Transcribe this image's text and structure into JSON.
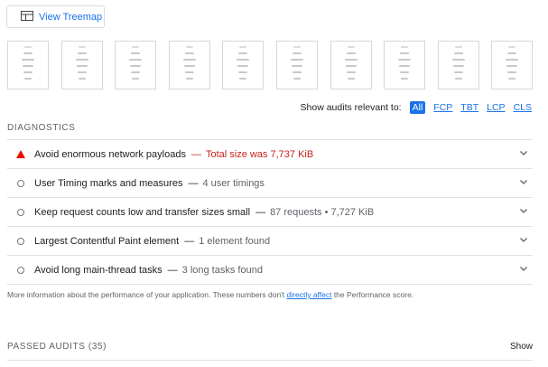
{
  "treemap_button": {
    "label": "View Treemap"
  },
  "filmstrip": {
    "frame_count": 10
  },
  "relevant": {
    "label": "Show audits relevant to:",
    "metrics": [
      "All",
      "FCP",
      "TBT",
      "LCP",
      "CLS"
    ],
    "active": "All"
  },
  "diagnostics": {
    "title": "DIAGNOSTICS",
    "audits": [
      {
        "status": "fail",
        "title": "Avoid enormous network payloads",
        "separator": "—",
        "display": "Total size was 7,737 KiB"
      },
      {
        "status": "info",
        "title": "User Timing marks and measures",
        "separator": "—",
        "display": "4 user timings"
      },
      {
        "status": "info",
        "title": "Keep request counts low and transfer sizes small",
        "separator": "—",
        "display": "87 requests • 7,727 KiB"
      },
      {
        "status": "info",
        "title": "Largest Contentful Paint element",
        "separator": "—",
        "display": "1 element found"
      },
      {
        "status": "info",
        "title": "Avoid long main-thread tasks",
        "separator": "—",
        "display": "3 long tasks found"
      }
    ],
    "more_info_before": "More information about the performance of your application. These numbers don't ",
    "more_info_link": "directly affect",
    "more_info_after": " the Performance score."
  },
  "passed": {
    "title": "PASSED AUDITS (35)",
    "toggle": "Show"
  },
  "colors": {
    "accent": "#1a73e8",
    "fail": "#c5221f",
    "fail_icon": "#eb0f00"
  }
}
